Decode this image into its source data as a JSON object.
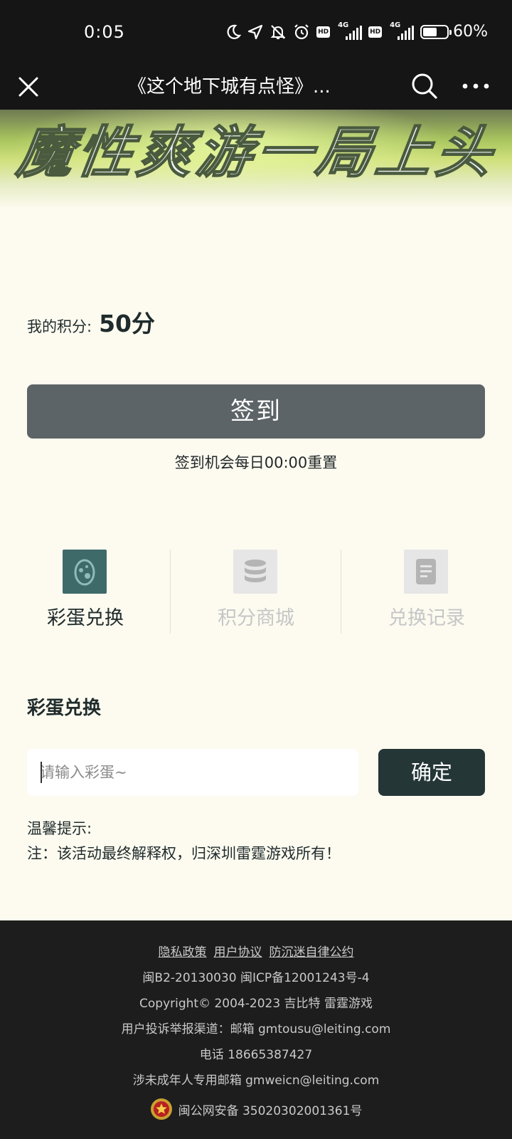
{
  "status_bar": {
    "time": "0:05",
    "network": "4G",
    "hd": "HD",
    "battery_text": "60%",
    "battery_level": 0.6,
    "icons": [
      "moon-icon",
      "location-arrow-icon",
      "mute-bell-icon",
      "alarm-icon",
      "hd-icon",
      "signal-icon",
      "battery-icon"
    ]
  },
  "nav": {
    "title": "《这个地下城有点怪》...",
    "close_icon": "close-icon",
    "search_icon": "search-icon",
    "more_icon": "more-icon"
  },
  "banner": {
    "text": "魔性爽游一局上头"
  },
  "points": {
    "label": "我的积分:",
    "value": "50分"
  },
  "checkin": {
    "button_label": "签到",
    "note": "签到机会每日00:00重置"
  },
  "tabs": [
    {
      "label": "彩蛋兑换",
      "icon": "egg-icon",
      "active": true
    },
    {
      "label": "积分商城",
      "icon": "database-icon",
      "active": false
    },
    {
      "label": "兑换记录",
      "icon": "document-icon",
      "active": false
    }
  ],
  "egg_exchange": {
    "title": "彩蛋兑换",
    "input_placeholder": "请输入彩蛋~",
    "input_value": "",
    "confirm_label": "确定"
  },
  "tips": {
    "title": "温馨提示:",
    "note": "注：该活动最终解释权，归深圳雷霆游戏所有！"
  },
  "footer": {
    "links": [
      "隐私政策",
      "用户协议",
      "防沉迷自律公约"
    ],
    "license": "闽B2-20130030  闽ICP备12001243号-4",
    "copyright": "Copyright© 2004-2023  吉比特  雷霆游戏",
    "complaint": "用户投诉举报渠道：邮箱 gmtousu@leiting.com",
    "phone": "电话 18665387427",
    "minor_email": "涉未成年人专用邮箱 gmweicn@leiting.com",
    "police_record": "闽公网安备 35020302001361号",
    "police_icon": "police-badge-icon"
  },
  "colors": {
    "page_bg": "#fdfbf0",
    "header_bg": "#151515",
    "checkin_button": "#5d6467",
    "confirm_button": "#243636",
    "active_tab_icon": "#3f6a6a",
    "inactive_tab_icon": "#e6e6e6",
    "footer_bg": "#1d1d1d"
  }
}
